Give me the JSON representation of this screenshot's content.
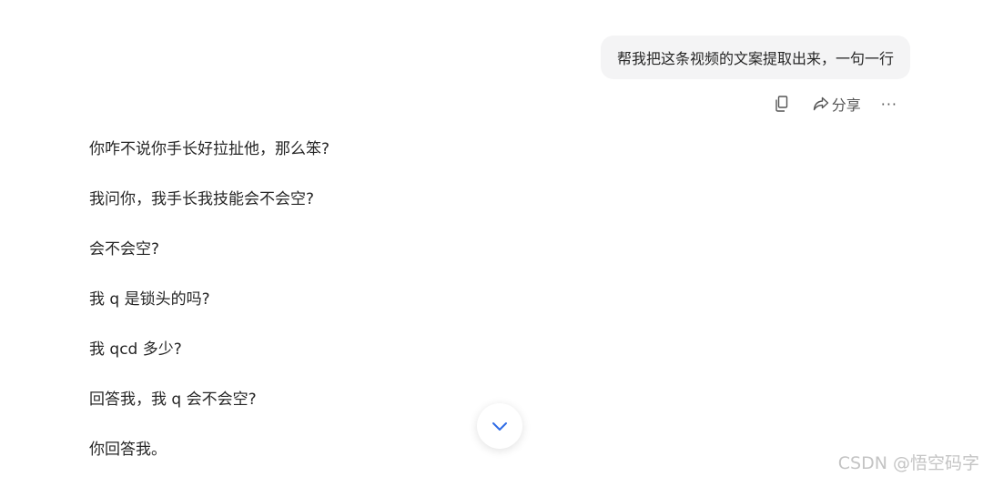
{
  "user_message": "帮我把这条视频的文案提取出来，一句一行",
  "actions": {
    "copy_icon": "copy-icon",
    "share_icon": "share-icon",
    "share_label": "分享",
    "more_label": "···"
  },
  "answer_lines": [
    "你咋不说你手长好拉扯他，那么笨?",
    "我问你，我手长我技能会不会空?",
    "会不会空?",
    "我 q 是锁头的吗?",
    "我 qcd 多少?",
    "回答我，我 q 会不会空?",
    "你回答我。"
  ],
  "scroll_button_icon": "chevron-down-icon",
  "watermark": "CSDN @悟空码字",
  "colors": {
    "bubble_bg": "#f4f4f5",
    "accent": "#2e6be6",
    "watermark": "#c4c4c4"
  }
}
